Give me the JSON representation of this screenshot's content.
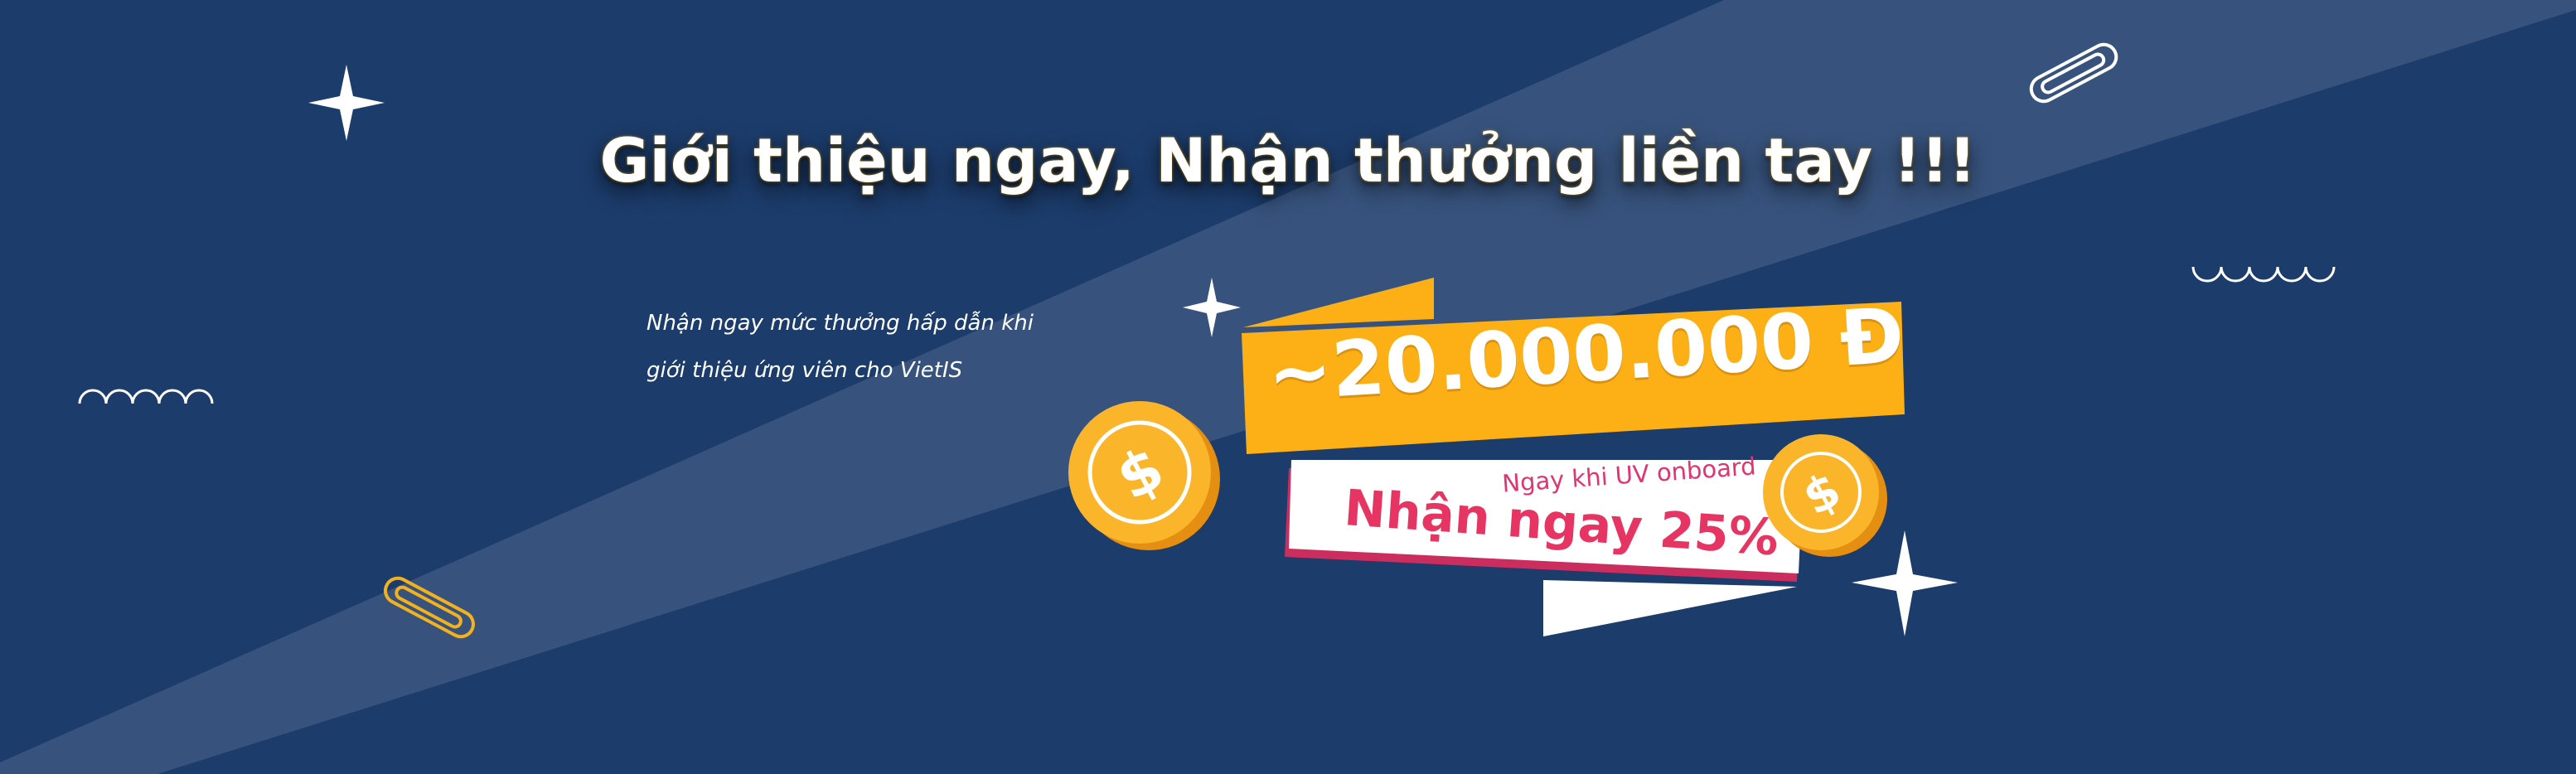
{
  "headline": "Giới thiệu ngay, Nhận thưởng liền tay !!!",
  "subtext": {
    "line1": "Nhận ngay mức thưởng hấp dẫn khi",
    "line2": "giới thiệu ứng viên cho VietIS"
  },
  "reward": {
    "amount": "~20.000.000 Đ",
    "condition": "Ngay khi UV onboard",
    "percent": "Nhận ngay 25%"
  },
  "colors": {
    "background": "#1c3c6b",
    "ribbon_yellow": "#fdb015",
    "ribbon_pink": "#e63463",
    "coin": "#fbb52b"
  },
  "icons": [
    "sparkle-icon",
    "paperclip-icon",
    "wave-icon",
    "dollar-coin-icon"
  ]
}
